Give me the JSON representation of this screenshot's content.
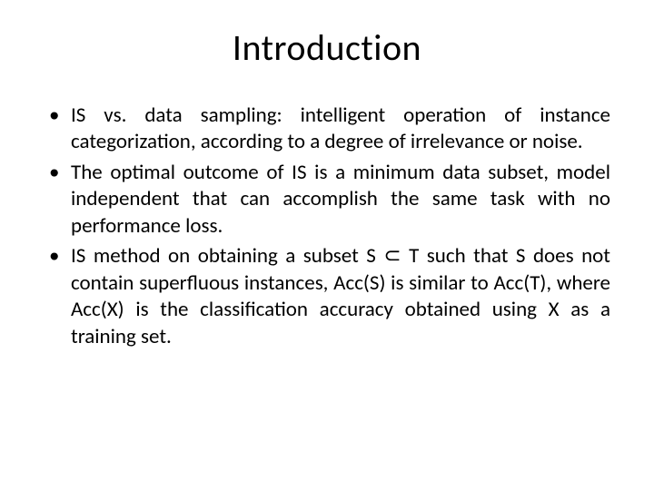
{
  "title": "Introduction",
  "bullets": [
    "IS vs. data sampling: intelligent operation of instance categorization, according to a degree of irrelevance or noise.",
    "The optimal outcome of IS is a minimum data subset, model independent that can accomplish the same task with no performance loss.",
    "IS method on obtaining a subset S ⊂ T such that S does not contain superfluous instances, Acc(S) is similar to Acc(T), where Acc(X) is the classification accuracy obtained using X as a training set."
  ]
}
